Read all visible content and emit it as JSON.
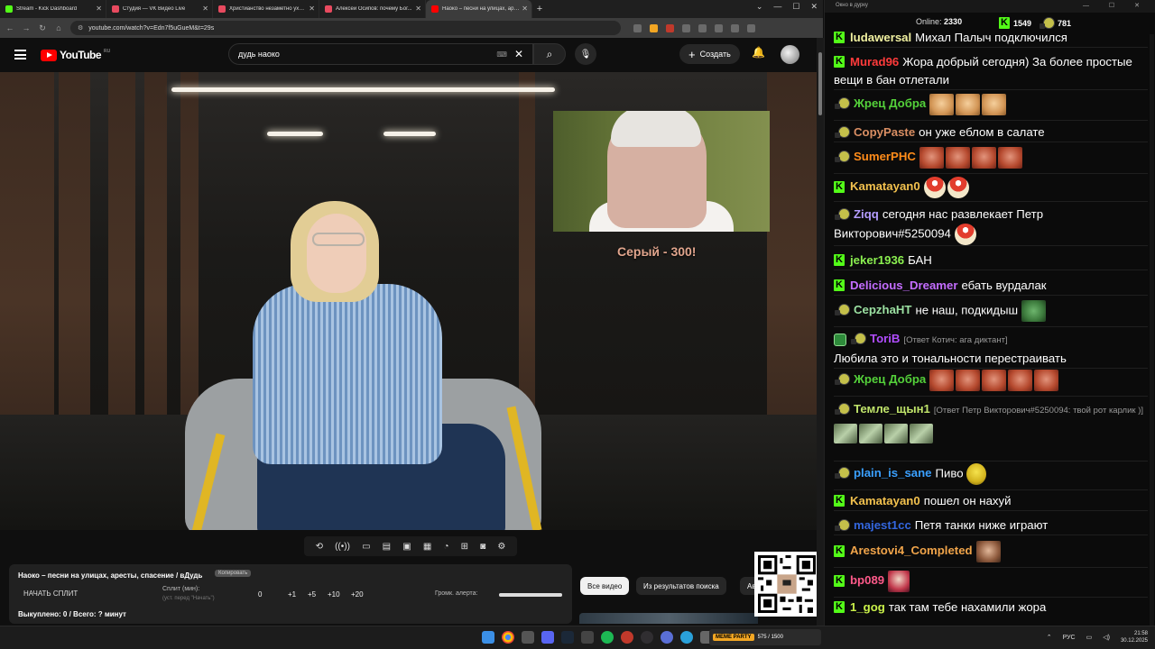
{
  "browser": {
    "tabs": [
      {
        "title": "Stream - Kick Dashboard",
        "color": "#53fc18"
      },
      {
        "title": "Студия — VK Видео Live",
        "color": "#e84a5f"
      },
      {
        "title": "Христианство незаметно уход...",
        "color": "#e84a5f"
      },
      {
        "title": "Алексей Осипов: почему Бог...",
        "color": "#e84a5f"
      },
      {
        "title": "Наоко – песни на улицах, арес...",
        "color": "#ff0000",
        "active": true
      }
    ],
    "url": "youtube.com/watch?v=Edn7f5uGueM&t=29s"
  },
  "youtube": {
    "logo_text": "YouTube",
    "region": "RU",
    "search_value": "дудь наоко",
    "create_label": "Создать",
    "caption": "Серый - 300!",
    "chips": [
      "Все видео",
      "Из результатов поиска",
      "Ав"
    ]
  },
  "split_panel": {
    "title": "Наоко – песни на улицах, аресты, спасение / вДудь",
    "copy_label": "Копировать",
    "start_label": "НАЧАТЬ СПЛИТ",
    "split_label": "Сплит (мин):",
    "split_hint": "(уст. перед \"Начать\")",
    "split_value": "0",
    "steps": [
      "+1",
      "+5",
      "+10",
      "+20"
    ],
    "alert_label": "Громк. алерта:",
    "alert_volume": 1.0,
    "bought": "Выкуплено: 0 / Всего: ? минут"
  },
  "chat": {
    "window_title": "Окно в дурку",
    "online_label": "Online:",
    "online_count": "2330",
    "kick_count": "1549",
    "other_count": "781",
    "messages": [
      {
        "badge": "kick",
        "nick": "ludawersal",
        "color": "#f0f0a0",
        "text": "Михал Палыч подключился"
      },
      {
        "badge": "kick",
        "nick": "Murad96",
        "color": "#ff3b3b",
        "text": "Жора добрый сегодня) За более простые вещи в бан отлетали"
      },
      {
        "badge": "emo",
        "nick": "Жрец Добра",
        "color": "#54d13a",
        "text": ""
      },
      {
        "badge": "emo",
        "nick": "CopyPaste",
        "color": "#d98e63",
        "text": "он уже еблом в салате"
      },
      {
        "badge": "emo",
        "nick": "SumerPHC",
        "color": "#ff8c1a",
        "text": ""
      },
      {
        "badge": "kick",
        "nick": "Kamatayan0",
        "color": "#f2c14e",
        "text": ""
      },
      {
        "badge": "emo",
        "nick": "Ziqq",
        "color": "#b49cff",
        "text": "сегодня нас развлекает Петр Викторович#5250094"
      },
      {
        "badge": "kick",
        "nick": "jeker1936",
        "color": "#8bf050",
        "text": "БАН"
      },
      {
        "badge": "kick",
        "nick": "Delicious_Dreamer",
        "color": "#c46dff",
        "text": "ебать вурдалак"
      },
      {
        "badge": "emo",
        "nick": "CepzhaHT",
        "color": "#9be0a1",
        "text": "не наш, подкидыш"
      },
      {
        "badge": "sub",
        "nick": "ToriB",
        "color": "#b14dff",
        "reply": "[Ответ Котич: ага диктант]",
        "text": "Любила это и тональности перестраивать"
      },
      {
        "badge": "emo",
        "nick": "Жрец Добра",
        "color": "#54d13a",
        "text": ""
      },
      {
        "badge": "emo",
        "nick": "Темле_щын1",
        "color": "#bfe36a",
        "reply": "[Ответ Петр Викторович#5250094: твой рот карлик )]",
        "text": ""
      },
      {
        "badge": "emo",
        "nick": "plain_is_sane",
        "color": "#3aa0ff",
        "text": "Пиво"
      },
      {
        "badge": "kick",
        "nick": "Kamatayan0",
        "color": "#f2c14e",
        "text": "пошел он нахуй"
      },
      {
        "badge": "emo",
        "nick": "majest1cc",
        "color": "#3366dd",
        "text": "Петя танки ниже играют"
      },
      {
        "badge": "kick",
        "nick": "Arestovi4_Completed",
        "color": "#f0a44a",
        "text": ""
      },
      {
        "badge": "kick",
        "nick": "bp089",
        "color": "#ff5a8a",
        "text": ""
      },
      {
        "badge": "kick",
        "nick": "1_gog",
        "color": "#c9f04a",
        "text": "так там тебе нахамили жора"
      }
    ]
  },
  "taskbar": {
    "meme_badge": "MEME PARTY",
    "meme_text": "575 / 1500",
    "lang": "РУС",
    "time": "21:58",
    "date": "30.12.2025"
  }
}
